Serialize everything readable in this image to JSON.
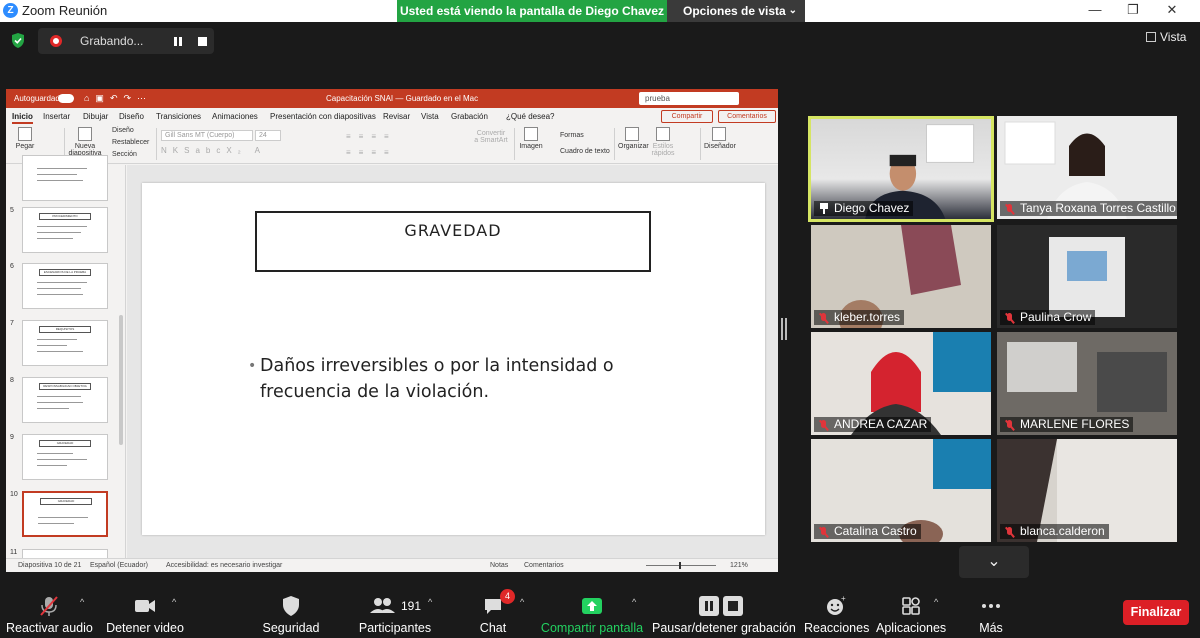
{
  "window": {
    "title": "Zoom Reunión",
    "banner_text": "Usted está viendo la pantalla de Diego Chavez",
    "view_options_label": "Opciones de vista",
    "minimize": "—",
    "restore": "❐",
    "close": "✕"
  },
  "topbar": {
    "recording_label": "Grabando...",
    "view_label": "Vista"
  },
  "ppt": {
    "autosave_label": "Autoguardado",
    "doc_title": "Capacitación SNAI — Guardado en el Mac",
    "search_value": "prueba",
    "tabs": [
      "Inicio",
      "Insertar",
      "Dibujar",
      "Diseño",
      "Transiciones",
      "Animaciones",
      "Presentación con diapositivas",
      "Revisar",
      "Vista",
      "Grabación",
      "¿Qué desea?"
    ],
    "share_label": "Compartir",
    "comments_label": "Comentarios",
    "ribbon": {
      "paste": "Pegar",
      "new_slide": "Nueva diapositiva",
      "layout": "Diseño",
      "reset": "Restablecer",
      "section": "Sección",
      "font": "Gill Sans MT (Cuerpo)",
      "size": "24",
      "convert": "Convertir a SmartArt",
      "image": "Imagen",
      "shapes": "Formas",
      "textbox": "Cuadro de texto",
      "arrange": "Organizar",
      "quick_styles": "Estilos rápidos",
      "designer": "Diseñador"
    },
    "slide_numbers": [
      "5",
      "6",
      "7",
      "8",
      "9",
      "10",
      "11"
    ],
    "thumb_titles": [
      "PROCEDIMIENTO",
      "ESCENARIOS DE LA PRUEBA",
      "REQUISITOS",
      "RESPONSABILIDAD OBJETIVA",
      "GRAVEDAD",
      "GRAVEDAD"
    ],
    "slide": {
      "title": "GRAVEDAD",
      "bullet": "Daños irreversibles o por la intensidad o frecuencia de la violación."
    },
    "status": {
      "slide_info": "Diapositiva 10 de 21",
      "language": "Español (Ecuador)",
      "accessibility": "Accesibilidad: es necesario investigar",
      "notes": "Notas",
      "comments": "Comentarios",
      "zoom": "121%"
    }
  },
  "participants": [
    {
      "name": "Diego Chavez",
      "muted": false,
      "pinned": true,
      "active": true
    },
    {
      "name": "Tanya Roxana Torres Castillo",
      "muted": true
    },
    {
      "name": "kleber.torres",
      "muted": true
    },
    {
      "name": "Paulina Crow",
      "muted": true
    },
    {
      "name": "ANDREA CAZAR",
      "muted": true
    },
    {
      "name": "MARLENE FLORES",
      "muted": true
    },
    {
      "name": "Catalina Castro",
      "muted": true
    },
    {
      "name": "blanca.calderon",
      "muted": true
    }
  ],
  "toolbar": {
    "unmute": "Reactivar audio",
    "video": "Detener video",
    "security": "Seguridad",
    "participants": "Participantes",
    "participants_count": "191",
    "chat": "Chat",
    "chat_badge": "4",
    "share": "Compartir pantalla",
    "record": "Pausar/detener grabación",
    "reactions": "Reacciones",
    "apps": "Aplicaciones",
    "more": "Más",
    "end": "Finalizar"
  },
  "colors": {
    "banner_green": "#23a443",
    "end_red": "#dc1f26",
    "ppt_red": "#c23b22",
    "active_speaker": "#d6e563"
  }
}
